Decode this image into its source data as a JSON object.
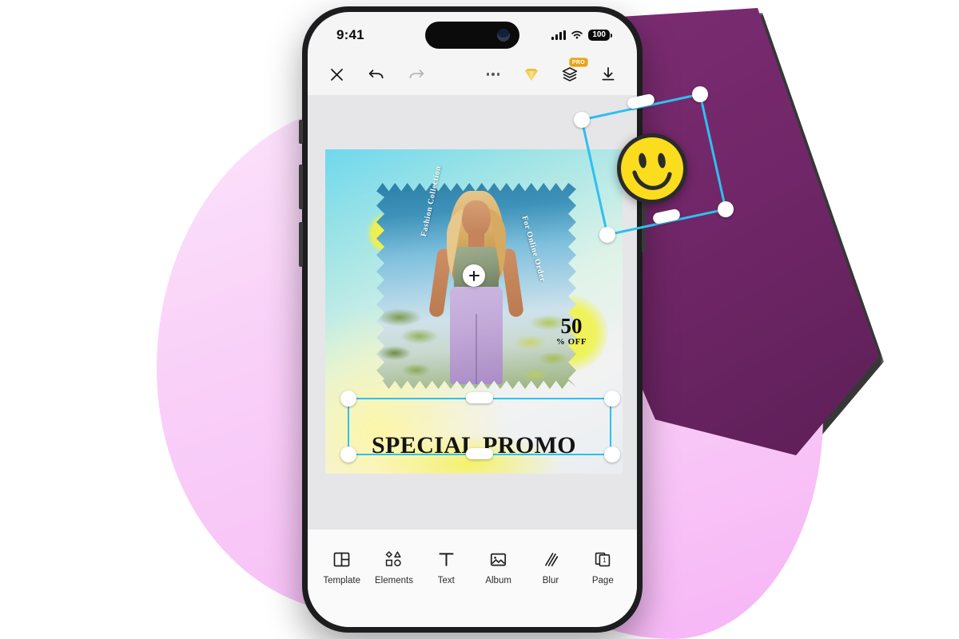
{
  "statusbar": {
    "time": "9:41",
    "battery": "100",
    "signal_icon": "cellular-signal-icon",
    "wifi_icon": "wifi-icon",
    "battery_icon": "battery-icon"
  },
  "toolbar": {
    "close_label": "close-icon",
    "undo_label": "undo-icon",
    "redo_label": "redo-icon",
    "more_label": "more-options-icon",
    "gem_label": "premium-gem-icon",
    "layers_label": "layers-icon",
    "pro_badge": "PRO",
    "download_label": "download-icon"
  },
  "canvas": {
    "vertical_text_left": "Fashion Collection",
    "vertical_text_right": "For Online Order",
    "discount_number": "50",
    "discount_suffix": "% OFF",
    "headline": "SPECIAL PROMO",
    "add_photo_label": "+"
  },
  "selection": {
    "accent_color": "#2ec0f0",
    "handle_color": "#ffffff",
    "sticker_name": "smiley-face-sticker"
  },
  "bottomnav": {
    "items": [
      {
        "label": "Template",
        "icon": "template-icon"
      },
      {
        "label": "Elements",
        "icon": "elements-icon"
      },
      {
        "label": "Text",
        "icon": "text-icon"
      },
      {
        "label": "Album",
        "icon": "album-icon"
      },
      {
        "label": "Blur",
        "icon": "blur-icon"
      },
      {
        "label": "Page",
        "icon": "page-icon"
      }
    ],
    "page_count": "1"
  },
  "colors": {
    "accent": "#2ec0f0",
    "pro_badge": "#e8a31c",
    "gem": "#f2cf5a",
    "blob_pink": "#f9d0f8",
    "blob_purple": "#6e2566",
    "sticker_yellow": "#fbdd1d"
  }
}
